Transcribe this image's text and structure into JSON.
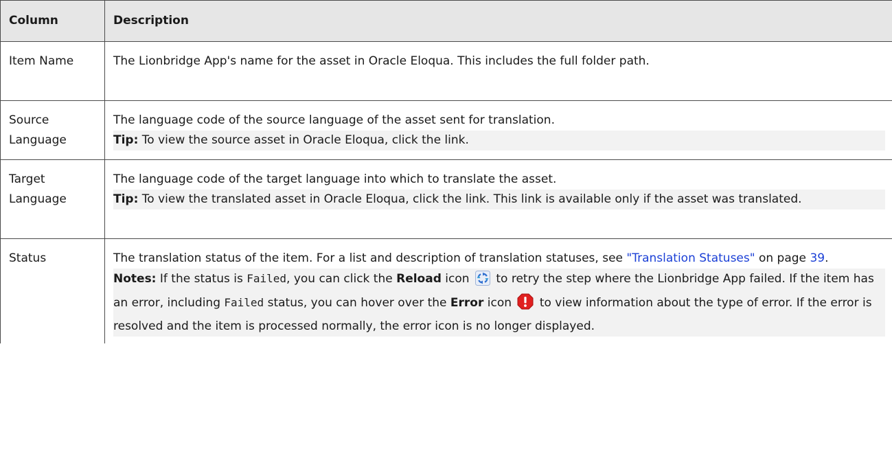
{
  "table": {
    "headers": [
      "Column",
      "Description"
    ],
    "rows": [
      {
        "column": "Item Name",
        "description": "The Lionbridge App's name for the asset in Oracle Eloqua. This includes the full folder path."
      },
      {
        "column": "Source Language",
        "description": "The language code of the source language of the asset sent for translation.",
        "tip_label": "Tip:",
        "tip_text": " To view the source asset in Oracle Eloqua, click the link."
      },
      {
        "column": "Target Language",
        "description": "The language code of the target language into which to translate the asset.",
        "tip_label": "Tip:",
        "tip_text": " To view the translated asset in Oracle Eloqua, click the link. This link is available only if the asset was translated."
      },
      {
        "column": "Status",
        "description_prefix": "The translation status of the item. For a list and description of translation statuses, see ",
        "link_text": "\"Translation Statuses\"",
        "on_page_text": " on page ",
        "page_number": "39",
        "period": ".",
        "notes_label": "Notes:",
        "notes_1": " If the status is ",
        "failed_code": "Failed",
        "notes_2": ", you can click the ",
        "reload_label": "Reload",
        "notes_3": " icon ",
        "notes_4": " to retry the step where the Lionbridge App failed. If the item has an error, including ",
        "failed_code_2": "Failed",
        "notes_5": " status, you can hover over the ",
        "error_label": "Error",
        "notes_6": " icon ",
        "notes_7": " to view information about the type of error. If the error is resolved and the item is processed normally, the error icon is no longer displayed."
      }
    ]
  },
  "icons": {
    "reload_icon": "reload-icon",
    "error_icon": "error-icon"
  },
  "colors": {
    "header_bg": "#e6e6e6",
    "link": "#1a3fd6",
    "note_bg": "#f2f2f2",
    "error_red": "#e02020",
    "reload_blue": "#2f6fd0"
  }
}
